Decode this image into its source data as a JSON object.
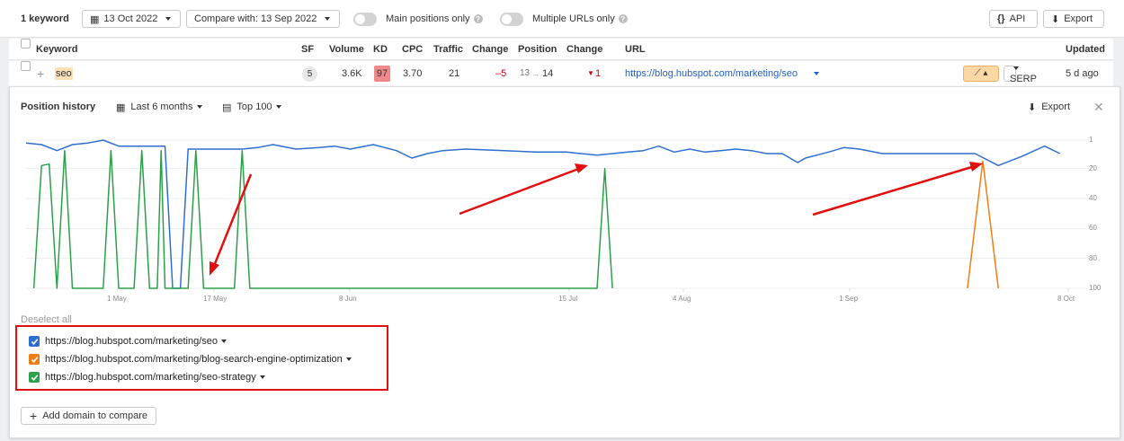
{
  "toolbar": {
    "keyword_count": "1 keyword",
    "date": "13 Oct 2022",
    "compare": "Compare with: 13 Sep 2022",
    "main_positions": "Main positions only",
    "multiple_urls": "Multiple URLs only",
    "api": "API",
    "export": "Export"
  },
  "table": {
    "headers": {
      "keyword": "Keyword",
      "sf": "SF",
      "volume": "Volume",
      "kd": "KD",
      "cpc": "CPC",
      "traffic": "Traffic",
      "change": "Change",
      "position": "Position",
      "pos_change": "Change",
      "url": "URL",
      "updated": "Updated"
    },
    "row": {
      "keyword": "seo",
      "sf": "5",
      "volume": "3.6K",
      "kd": "97",
      "cpc": "3.70",
      "traffic": "21",
      "change": "–5",
      "position_from": "13",
      "position_to": "14",
      "pos_change": "1",
      "url": "https://blog.hubspot.com/marketing/seo",
      "serp": "SERP",
      "updated": "5 d ago"
    }
  },
  "panel": {
    "title": "Position history",
    "period": "Last 6 months",
    "top": "Top 100",
    "export": "Export",
    "deselect": "Deselect all",
    "add_domain": "Add domain to compare"
  },
  "legend": [
    {
      "url": "https://blog.hubspot.com/marketing/seo",
      "color": "#2f6fd0"
    },
    {
      "url": "https://blog.hubspot.com/marketing/blog-search-engine-optimization",
      "color": "#ef7d14"
    },
    {
      "url": "https://blog.hubspot.com/marketing/seo-strategy",
      "color": "#2ca04a"
    }
  ],
  "colors": {
    "annotation": "#e01010",
    "kd": "#f08a8a",
    "negative": "#d0021b"
  },
  "chart_data": {
    "type": "line",
    "y_reversed": true,
    "ylim": [
      1,
      100
    ],
    "y_ticks": [
      "1",
      "20",
      "40",
      "60",
      "80",
      "100"
    ],
    "x_ticks": [
      "1 May",
      "17 May",
      "8 Jun",
      "15 Jul",
      "4 Aug",
      "1 Sep",
      "8 Oct"
    ],
    "grid": true,
    "series": [
      {
        "name": "https://blog.hubspot.com/marketing/seo",
        "color": "#2f6fd0",
        "points": [
          [
            0,
            3
          ],
          [
            2,
            4
          ],
          [
            4,
            8
          ],
          [
            6,
            4
          ],
          [
            8,
            3
          ],
          [
            10,
            1
          ],
          [
            12,
            5
          ],
          [
            16,
            5
          ],
          [
            18,
            5
          ],
          [
            19,
            100
          ],
          [
            20,
            100
          ],
          [
            21,
            7
          ],
          [
            24,
            7
          ],
          [
            26,
            7
          ],
          [
            28,
            7
          ],
          [
            30,
            6
          ],
          [
            32,
            4
          ],
          [
            35,
            7
          ],
          [
            38,
            6
          ],
          [
            40,
            5
          ],
          [
            42,
            7
          ],
          [
            45,
            4
          ],
          [
            48,
            8
          ],
          [
            50,
            13
          ],
          [
            52,
            10
          ],
          [
            54,
            8
          ],
          [
            57,
            7
          ],
          [
            62,
            8
          ],
          [
            66,
            9
          ],
          [
            70,
            9
          ],
          [
            74,
            11
          ],
          [
            78,
            9
          ],
          [
            80,
            8
          ],
          [
            82,
            5
          ],
          [
            84,
            9
          ],
          [
            86,
            7
          ],
          [
            88,
            9
          ],
          [
            90,
            8
          ],
          [
            92,
            7
          ],
          [
            94,
            8
          ],
          [
            96,
            10
          ],
          [
            98,
            10
          ],
          [
            100,
            16
          ],
          [
            101,
            13
          ],
          [
            104,
            9
          ],
          [
            106,
            6
          ],
          [
            108,
            7
          ],
          [
            111,
            10
          ],
          [
            114,
            10
          ],
          [
            117,
            10
          ],
          [
            120,
            10
          ],
          [
            123,
            10
          ],
          [
            126,
            18
          ],
          [
            129,
            12
          ],
          [
            132,
            5
          ],
          [
            134,
            10
          ]
        ]
      },
      {
        "name": "https://blog.hubspot.com/marketing/blog-search-engine-optimization",
        "color": "#ef7d14",
        "points": [
          [
            122,
            100
          ],
          [
            124,
            15
          ],
          [
            126,
            100
          ]
        ]
      },
      {
        "name": "https://blog.hubspot.com/marketing/seo-strategy",
        "color": "#2ca04a",
        "points": [
          [
            1,
            100
          ],
          [
            2,
            18
          ],
          [
            3,
            17
          ],
          [
            4,
            100
          ],
          [
            5,
            8
          ],
          [
            6,
            100
          ],
          [
            10,
            100
          ],
          [
            11,
            8
          ],
          [
            12,
            100
          ],
          [
            14,
            100
          ],
          [
            15,
            8
          ],
          [
            16,
            100
          ],
          [
            16.3,
            100
          ],
          [
            17,
            100
          ],
          [
            17.5,
            8
          ],
          [
            18,
            100
          ],
          [
            21,
            100
          ],
          [
            22,
            8
          ],
          [
            23,
            100
          ],
          [
            27,
            100
          ],
          [
            28,
            8
          ],
          [
            29,
            100
          ],
          [
            74,
            100
          ],
          [
            75,
            20
          ],
          [
            76,
            100
          ]
        ]
      }
    ]
  }
}
